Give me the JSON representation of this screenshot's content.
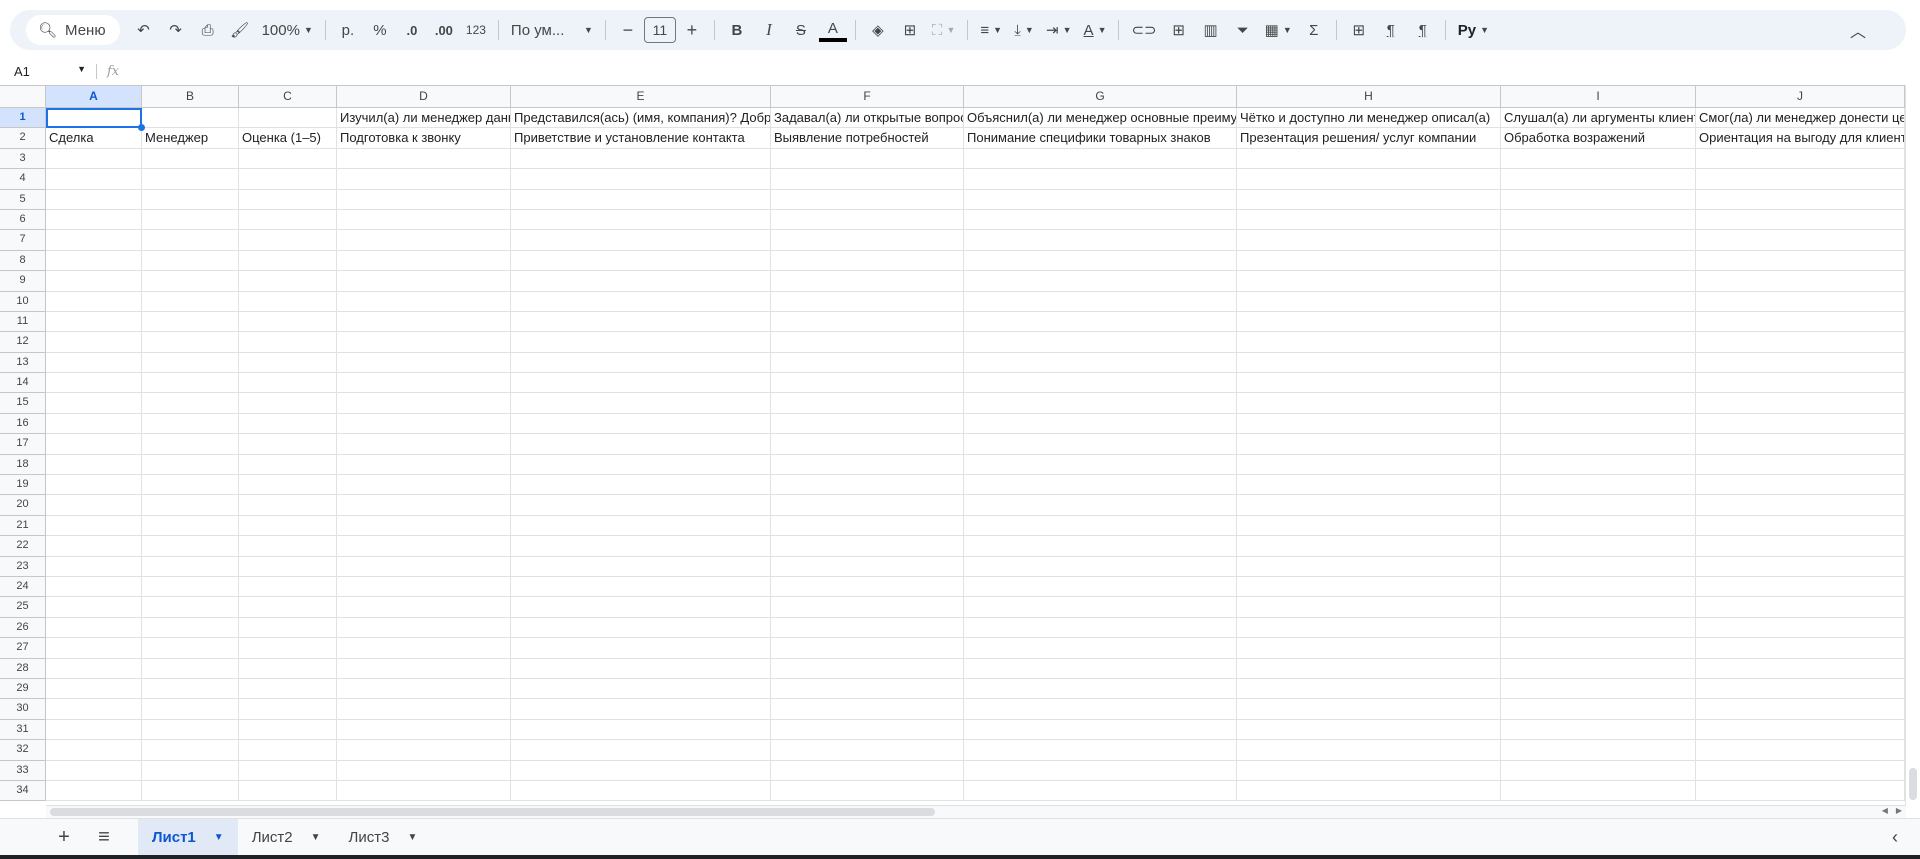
{
  "toolbar": {
    "menu_label": "Меню",
    "zoom": "100%",
    "currency": "р.",
    "percent": "%",
    "dec_decrease": ".0",
    "dec_increase": ".00",
    "format_more": "123",
    "font": "По ум...",
    "font_size": "11",
    "minus": "−",
    "plus": "+",
    "bold": "B",
    "italic": "I",
    "strike": "S",
    "text_color": "A",
    "rotate": "A",
    "sum": "Σ",
    "pilcrow_ltr": "¶",
    "pilcrow_rtl": "¶",
    "script": "Pу"
  },
  "formula_bar": {
    "cell_ref": "A1",
    "fx": "fx",
    "value": ""
  },
  "columns": [
    "A",
    "B",
    "C",
    "D",
    "E",
    "F",
    "G",
    "H",
    "I",
    "J"
  ],
  "rows": [
    [
      "",
      "",
      "",
      "Изучил(а) ли менеджер данные",
      "Представился(ась) (имя, компания)? Добрый день",
      "Задавал(а) ли открытые вопросы",
      "Объяснил(а) ли менеджер основные преимущества",
      "Чётко и доступно ли менеджер описал(а)",
      "Слушал(а) ли аргументы клиента",
      "Смог(ла) ли менеджер донести ценность"
    ],
    [
      "Сделка",
      "Менеджер",
      "Оценка (1–5)",
      "Подготовка к звонку",
      "Приветствие и установление контакта",
      "Выявление потребностей",
      "Понимание специфики товарных знаков",
      "Презентация решения/ услуг компании",
      "Обработка возражений",
      "Ориентация на выгоду для клиента"
    ]
  ],
  "visible_row_count": 34,
  "selected_cell": "A1",
  "sheets": [
    {
      "label": "Лист1",
      "active": true
    },
    {
      "label": "Лист2",
      "active": false
    },
    {
      "label": "Лист3",
      "active": false
    }
  ],
  "colors": {
    "accent": "#1a73e8",
    "selected_header": "#d3e3fd",
    "toolbar_bg": "#eef2f9"
  }
}
